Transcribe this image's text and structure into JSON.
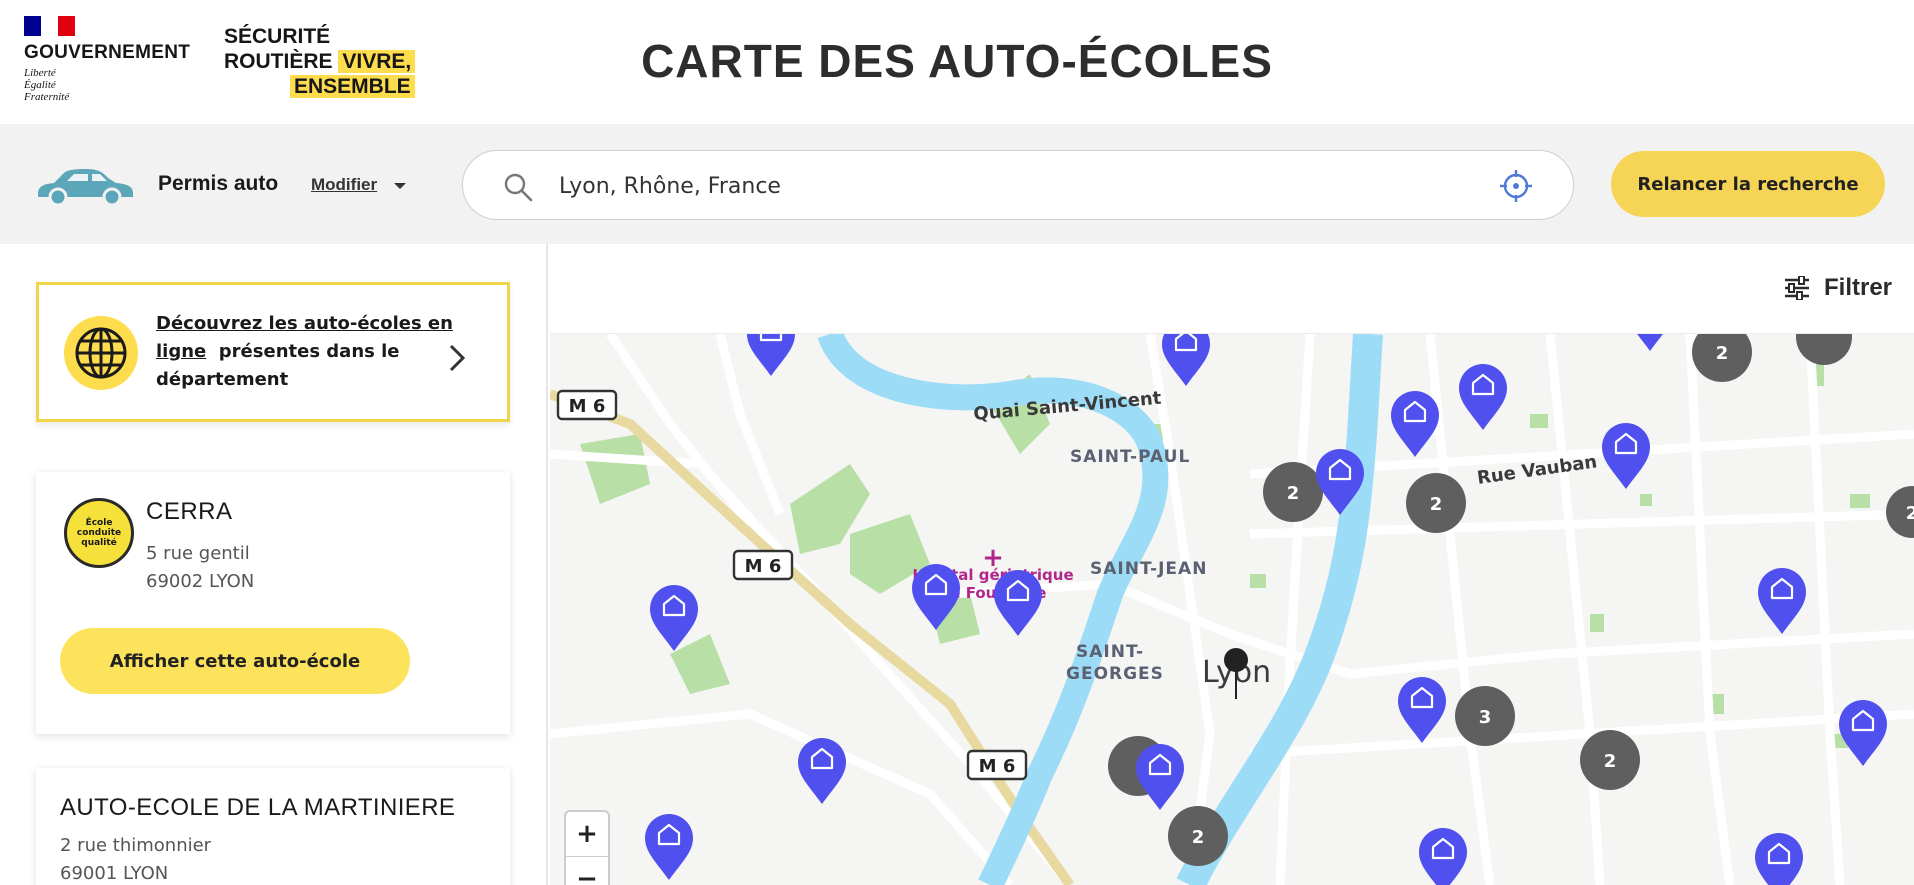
{
  "header": {
    "gov_name": "GOUVERNEMENT",
    "gov_motto": [
      "Liberté",
      "Égalité",
      "Fraternité"
    ],
    "secu_line1": "SÉCURITÉ",
    "secu_line2a": "ROUTIÈRE",
    "secu_line2b": "VIVRE,",
    "secu_line3": "ENSEMBLE",
    "title": "CARTE DES AUTO-ÉCOLES"
  },
  "searchbar": {
    "permis_label": "Permis auto",
    "modifier_label": "Modifier",
    "search_value": "Lyon, Rhône, France",
    "relancer_label": "Relancer la recherche"
  },
  "sidebar": {
    "promo": {
      "link_text_1": "Découvrez les auto-écoles en",
      "link_text_2": "ligne",
      "rest_text_1": "présentes dans le",
      "rest_text_2": "département"
    },
    "schools": [
      {
        "name": "CERRA",
        "street": "5 rue gentil",
        "city": "69002 LYON",
        "badge": "École conduite qualité",
        "button": "Afficher cette auto-école"
      },
      {
        "name": "AUTO-ECOLE DE LA MARTINIERE",
        "street": "2 rue thimonnier",
        "city": "69001 LYON"
      }
    ]
  },
  "filter": {
    "label": "Filtrer"
  },
  "map": {
    "labels": {
      "quai": "Quai Saint-Vincent",
      "saint_paul": "SAINT-PAUL",
      "saint_jean": "SAINT-JEAN",
      "saint_georges_1": "SAINT-",
      "saint_georges_2": "GEORGES",
      "hospital_1": "Hôpital gériatrique",
      "hospital_2": "de Fourvière",
      "rue_vauban": "Rue Vauban",
      "lyon": "Lyon",
      "m6": "M 6"
    },
    "cluster_counts": [
      "2",
      "2",
      "2",
      "2",
      "3",
      "2",
      "2"
    ],
    "zoom_in": "+",
    "zoom_out": "−",
    "colors": {
      "marker": "#5050ee",
      "cluster": "#5f5f5f",
      "water": "#9ddcf7",
      "park": "#b8e0a6"
    }
  }
}
